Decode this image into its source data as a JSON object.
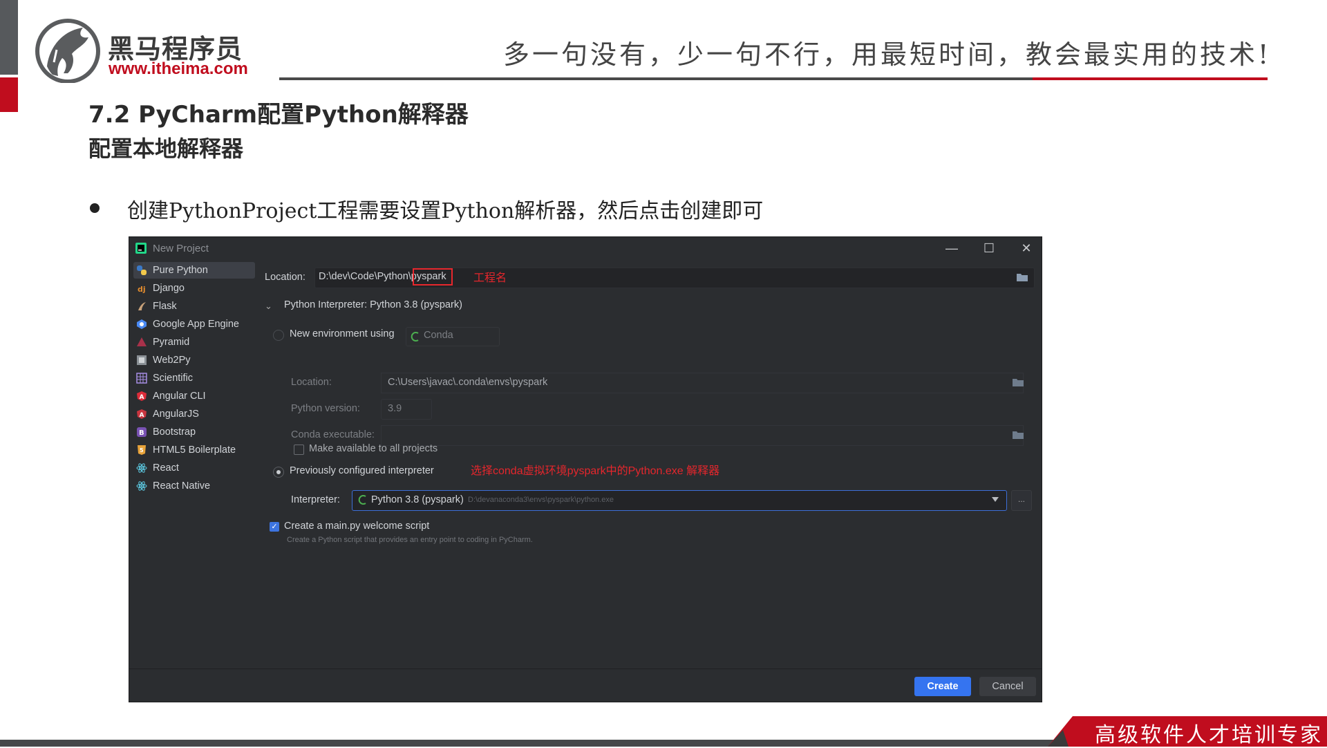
{
  "slide": {
    "brand_name": "黑马程序员",
    "brand_url": "www.itheima.com",
    "slogan": "多一句没有，少一句不行，用最短时间，教会最实用的技术!",
    "title_1": "7.2 PyCharm配置Python解释器",
    "title_2": "配置本地解释器",
    "bullet": "创建PythonProject工程需要设置Python解析器，然后点击创建即可",
    "footer": "高级软件人才培训专家",
    "colors": {
      "brand_red": "#c00d1e",
      "dark_gray": "#4a4a4a"
    }
  },
  "dialog": {
    "title": "New Project",
    "window_buttons": {
      "minimize": "—",
      "maximize": "☐",
      "close": "✕"
    },
    "sidebar": [
      {
        "label": "Pure Python",
        "icon": "python-icon",
        "selected": true
      },
      {
        "label": "Django",
        "icon": "django-icon"
      },
      {
        "label": "Flask",
        "icon": "flask-icon"
      },
      {
        "label": "Google App Engine",
        "icon": "google-app-engine-icon"
      },
      {
        "label": "Pyramid",
        "icon": "pyramid-icon"
      },
      {
        "label": "Web2Py",
        "icon": "web2py-icon"
      },
      {
        "label": "Scientific",
        "icon": "scientific-icon"
      },
      {
        "label": "Angular CLI",
        "icon": "angular-icon"
      },
      {
        "label": "AngularJS",
        "icon": "angularjs-icon"
      },
      {
        "label": "Bootstrap",
        "icon": "bootstrap-icon"
      },
      {
        "label": "HTML5 Boilerplate",
        "icon": "html5-icon"
      },
      {
        "label": "React",
        "icon": "react-icon"
      },
      {
        "label": "React Native",
        "icon": "react-native-icon"
      }
    ],
    "location_label": "Location:",
    "location_value": "D:\\dev\\Code\\Python\\pyspark",
    "annotation_project": "工程名",
    "interpreter_section": "Python Interpreter: Python 3.8 (pyspark)",
    "new_env_label": "New environment using",
    "new_env_tool": "Conda",
    "env_location_label": "Location:",
    "env_location_value": "C:\\Users\\javac\\.conda\\envs\\pyspark",
    "python_version_label": "Python version:",
    "python_version_value": "3.9",
    "conda_exe_label": "Conda executable:",
    "make_available_label": "Make available to all projects",
    "prev_interp_label": "Previously configured interpreter",
    "annotation_select": "选择conda虚拟环境pyspark中的Python.exe 解释器",
    "interpreter_label": "Interpreter:",
    "interpreter_value": "Python 3.8 (pyspark)",
    "interpreter_path": "D:\\devanaconda3\\envs\\pyspark\\python.exe",
    "browse_label": "...",
    "create_main_label": "Create a main.py welcome script",
    "create_main_desc": "Create a Python script that provides an entry point to coding in PyCharm.",
    "create_button": "Create",
    "cancel_button": "Cancel"
  }
}
